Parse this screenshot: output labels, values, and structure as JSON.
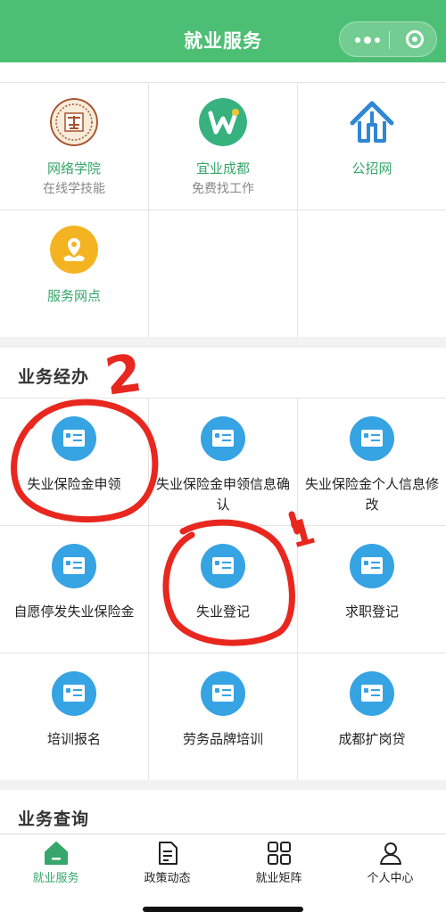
{
  "header": {
    "title": "就业服务"
  },
  "external_links": [
    {
      "label": "网络学院",
      "sub": "在线学技能",
      "icon": "cyber-academy-seal-icon",
      "color": "#a5542e"
    },
    {
      "label": "宜业成都",
      "sub": "免费找工作",
      "icon": "yiye-chengdu-w-icon",
      "color": "#37b27e"
    },
    {
      "label": "公招网",
      "sub": "",
      "icon": "public-recruit-logo-icon",
      "color": "#2f86d4"
    },
    {
      "label": "服务网点",
      "sub": "",
      "icon": "location-map-icon",
      "color": "#f4b321"
    }
  ],
  "business": {
    "title": "业务经办",
    "items": [
      {
        "label": "失业保险金申领"
      },
      {
        "label": "失业保险金申领信息确认"
      },
      {
        "label": "失业保险金个人信息修改"
      },
      {
        "label": "自愿停发失业保险金"
      },
      {
        "label": "失业登记"
      },
      {
        "label": "求职登记"
      },
      {
        "label": "培训报名"
      },
      {
        "label": "劳务品牌培训"
      },
      {
        "label": "成都扩岗贷"
      }
    ]
  },
  "query": {
    "title": "业务查询"
  },
  "tabbar": [
    {
      "label": "就业服务",
      "icon": "home-icon",
      "active": true
    },
    {
      "label": "政策动态",
      "icon": "document-icon",
      "active": false
    },
    {
      "label": "就业矩阵",
      "icon": "grid-icon",
      "active": false
    },
    {
      "label": "个人中心",
      "icon": "person-icon",
      "active": false
    }
  ],
  "annotations": {
    "mark_1": "1",
    "mark_2": "2"
  },
  "colors": {
    "brand_green": "#4cbf74",
    "link_green": "#36a66a",
    "icon_blue": "#36a3e3",
    "annotation_red": "#e8271f"
  }
}
